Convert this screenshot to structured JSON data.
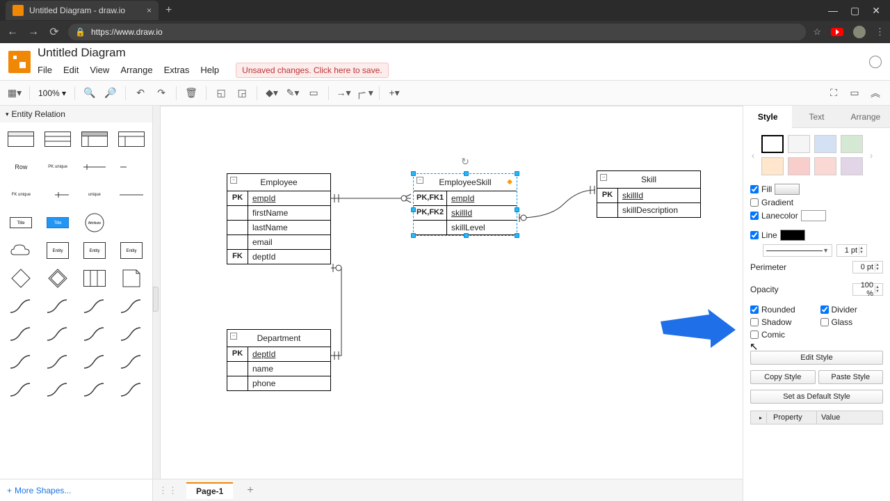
{
  "browser": {
    "tab_title": "Untitled Diagram - draw.io",
    "url": "https://www.draw.io"
  },
  "app": {
    "title": "Untitled Diagram",
    "menus": [
      "File",
      "Edit",
      "View",
      "Arrange",
      "Extras",
      "Help"
    ],
    "unsaved": "Unsaved changes. Click here to save."
  },
  "toolbar": {
    "zoom": "100%"
  },
  "sidebar": {
    "category": "Entity Relation",
    "more_shapes": "More Shapes..."
  },
  "canvas": {
    "entities": {
      "employee": {
        "title": "Employee",
        "rows": [
          {
            "key": "PK",
            "field": "empId",
            "underline": true
          },
          {
            "key": "",
            "field": "firstName"
          },
          {
            "key": "",
            "field": "lastName"
          },
          {
            "key": "",
            "field": "email"
          },
          {
            "key": "FK",
            "field": "deptId"
          }
        ]
      },
      "employeeSkill": {
        "title": "EmployeeSkill",
        "rows": [
          {
            "key": "PK,FK1",
            "field": "empId",
            "underline": true
          },
          {
            "key": "PK,FK2",
            "field": "skillId",
            "underline": true
          },
          {
            "key": "",
            "field": "skillLevel"
          }
        ]
      },
      "skill": {
        "title": "Skill",
        "rows": [
          {
            "key": "PK",
            "field": "skillId",
            "underline": true
          },
          {
            "key": "",
            "field": "skillDescription"
          }
        ]
      },
      "department": {
        "title": "Department",
        "rows": [
          {
            "key": "PK",
            "field": "deptId",
            "underline": true
          },
          {
            "key": "",
            "field": "name"
          },
          {
            "key": "",
            "field": "phone"
          }
        ]
      }
    }
  },
  "pages": {
    "current": "Page-1"
  },
  "format": {
    "tabs": [
      "Style",
      "Text",
      "Arrange"
    ],
    "swatches": [
      "#ffffff",
      "#f5f5f5",
      "#d4e1f5",
      "#d5e8d4",
      "#ffe6cc",
      "#f8cecc",
      "#fad9d5",
      "#e1d5e7"
    ],
    "fill_label": "Fill",
    "gradient_label": "Gradient",
    "lanecolor_label": "Lanecolor",
    "line_label": "Line",
    "line_width": "1 pt",
    "perimeter_label": "Perimeter",
    "perimeter_val": "0 pt",
    "opacity_label": "Opacity",
    "opacity_val": "100 %",
    "rounded": "Rounded",
    "divider": "Divider",
    "shadow": "Shadow",
    "glass": "Glass",
    "comic": "Comic",
    "edit_style": "Edit Style",
    "copy_style": "Copy Style",
    "paste_style": "Paste Style",
    "set_default": "Set as Default Style",
    "property": "Property",
    "value": "Value"
  }
}
